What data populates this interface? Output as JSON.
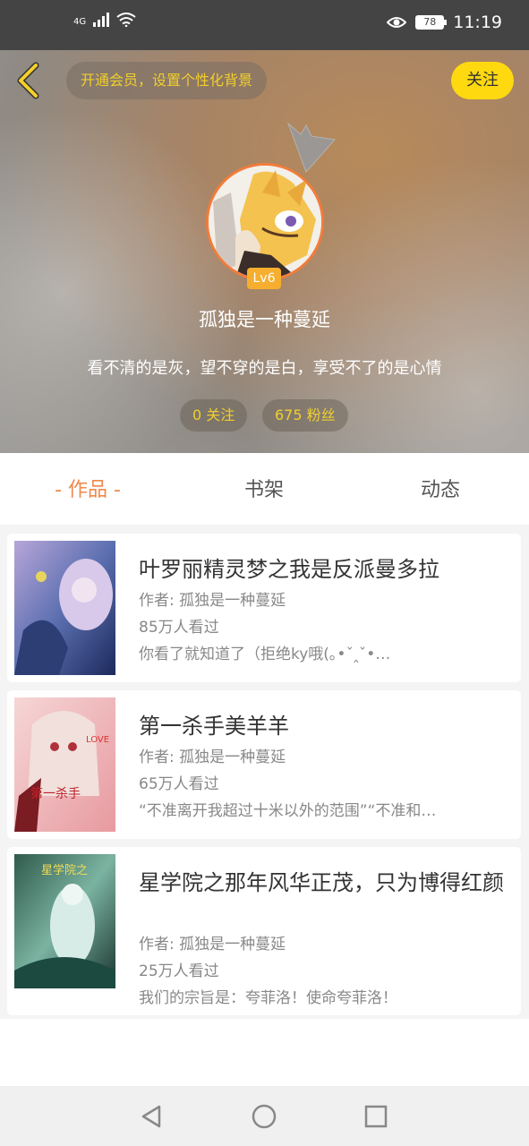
{
  "status_bar": {
    "network": "4G",
    "battery": "78",
    "time": "11:19"
  },
  "header": {
    "vip_prompt": "开通会员，设置个性化背景",
    "follow_label": "关注",
    "level": "Lv6",
    "username": "孤独是一种蔓延",
    "bio": "看不清的是灰，望不穿的是白，享受不了的是心情",
    "following": "0 关注",
    "fans": "675 粉丝"
  },
  "tabs": [
    {
      "label": "- 作品 -",
      "active": true
    },
    {
      "label": "书架",
      "active": false
    },
    {
      "label": "动态",
      "active": false
    }
  ],
  "books": [
    {
      "title": "叶罗丽精灵梦之我是反派曼多拉",
      "author": "作者: 孤独是一种蔓延",
      "views": "85万人看过",
      "desc": "你看了就知道了（拒绝ky哦(｡•ˇ‸ˇ•…"
    },
    {
      "title": "第一杀手美羊羊",
      "author": "作者: 孤独是一种蔓延",
      "views": "65万人看过",
      "desc": "“不准离开我超过十米以外的范围”“不准和…"
    },
    {
      "title": "星学院之那年风华正茂，只为博得红颜",
      "author": "作者: 孤独是一种蔓延",
      "views": "25万人看过",
      "desc": "我们的宗旨是：夸菲洛！使命夸菲洛！"
    }
  ],
  "colors": {
    "accent": "#f0884b",
    "follow_yellow": "#ffd90f",
    "vip_text": "#f2cf2c"
  }
}
